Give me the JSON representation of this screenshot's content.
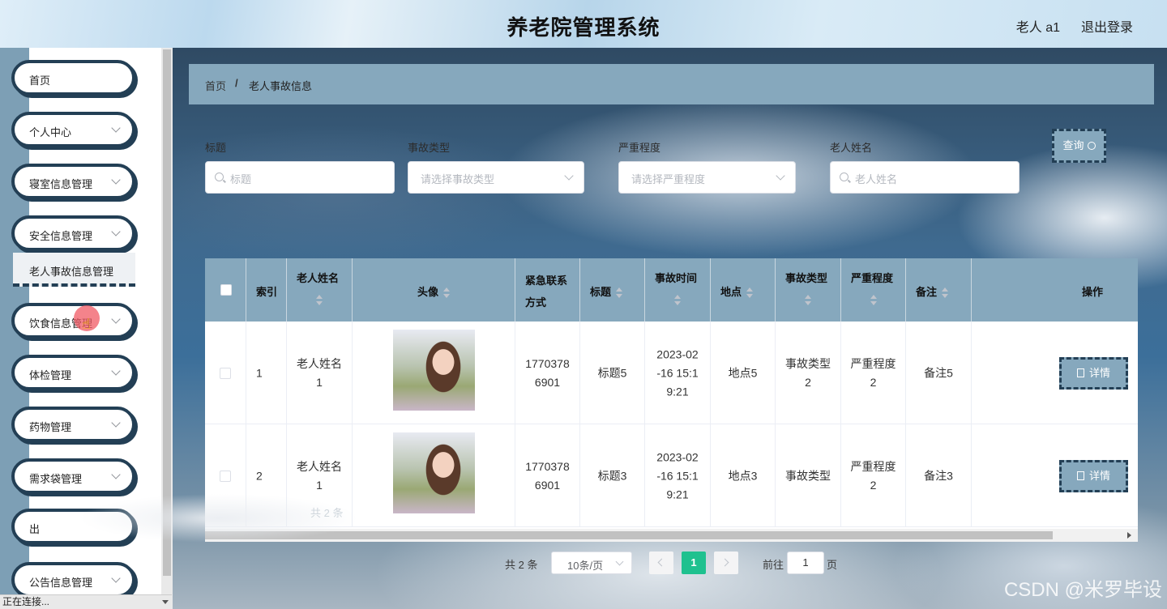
{
  "header": {
    "title": "养老院管理系统",
    "user": "老人 a1",
    "logout": "退出登录"
  },
  "sidebar": {
    "items": [
      {
        "label": "首页"
      },
      {
        "label": "个人中心"
      },
      {
        "label": "寝室信息管理"
      },
      {
        "label": "安全信息管理"
      },
      {
        "label": "饮食信息管理"
      },
      {
        "label": "体检管理"
      },
      {
        "label": "药物管理"
      },
      {
        "label": "需求袋管理"
      },
      {
        "label": "出"
      },
      {
        "label": "公告信息管理"
      }
    ],
    "submenu": "老人事故信息管理"
  },
  "breadcrumb": {
    "home": "首页",
    "separator": "/",
    "current": "老人事故信息"
  },
  "filters": {
    "title": {
      "label": "标题",
      "placeholder": "标题"
    },
    "type": {
      "label": "事故类型",
      "placeholder": "请选择事故类型"
    },
    "severity": {
      "label": "严重程度",
      "placeholder": "请选择严重程度"
    },
    "name": {
      "label": "老人姓名",
      "placeholder": "老人姓名"
    },
    "query_button": "查询"
  },
  "table": {
    "headers": {
      "index": "索引",
      "name": "老人姓名",
      "avatar": "头像",
      "contact_1": "紧急联系",
      "contact_2": "方式",
      "title": "标题",
      "time": "事故时间",
      "place": "地点",
      "type": "事故类型",
      "severity": "严重程度",
      "remark": "备注",
      "action": "操作"
    },
    "rows": [
      {
        "index": "1",
        "name": "老人姓名\n1",
        "contact": "1770378\n6901",
        "title": "标题5",
        "time": "2023-02\n-16 15:1\n9:21",
        "place": "地点5",
        "type": "事故类型\n2",
        "severity": "严重程度\n2",
        "remark": "备注5",
        "action": "详情"
      },
      {
        "index": "2",
        "name": "老人姓名\n1",
        "contact": "1770378\n6901",
        "title": "标题3",
        "time": "2023-02\n-16 15:1\n9:21",
        "place": "地点3",
        "type": "事故类型",
        "severity": "严重程度\n2",
        "remark": "备注3",
        "action": "详情"
      }
    ]
  },
  "pagination": {
    "total": "共 2 条",
    "total_faded": "共 2 条",
    "page_size": "10条/页",
    "current": "1",
    "goto_label": "前往",
    "goto_value": "1",
    "page_suffix": "页"
  },
  "watermark": "CSDN @米罗毕设",
  "status": "正在连接..."
}
